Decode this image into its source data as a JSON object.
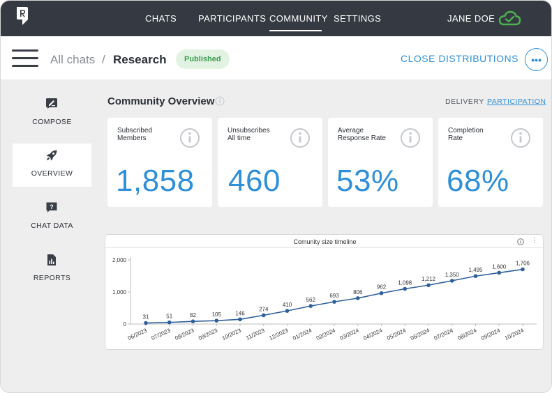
{
  "nav": {
    "items": [
      "CHATS",
      "PARTICIPANTS",
      "COMMUNITY",
      "SETTINGS"
    ],
    "active": "COMMUNITY",
    "user_name": "JANE DOE"
  },
  "header": {
    "breadcrumb_all": "All chats",
    "breadcrumb_sep": "/",
    "breadcrumb_current": "Research",
    "status_badge": "Published",
    "close_distributions": "CLOSE DISTRIBUTIONS",
    "more_label": "•••"
  },
  "sidebar": {
    "items": [
      {
        "label": "COMPOSE",
        "icon": "compose-icon",
        "active": false
      },
      {
        "label": "OVERVIEW",
        "icon": "rocket-icon",
        "active": true
      },
      {
        "label": "CHAT DATA",
        "icon": "chat-data-icon",
        "active": false
      },
      {
        "label": "REPORTS",
        "icon": "reports-icon",
        "active": false
      }
    ]
  },
  "overview": {
    "title": "Community Overview",
    "tabs": {
      "delivery": "DELIVERY",
      "participation": "PARTICIPATION",
      "active": "PARTICIPATION"
    },
    "cards": [
      {
        "label_line1": "Subscribed",
        "label_line2": "Members",
        "value": "1,858"
      },
      {
        "label_line1": "Unsubscribes",
        "label_line2": "All time",
        "value": "460"
      },
      {
        "label_line1": "Average",
        "label_line2": "Response Rate",
        "value": "53%"
      },
      {
        "label_line1": "Completion",
        "label_line2": "Rate",
        "value": "68%"
      }
    ]
  },
  "colors": {
    "accent": "#2f8fd8",
    "topbar": "#353a42",
    "line": "#2e5f9c",
    "published_text": "#3c9a4d",
    "published_bg": "#e3f3e3",
    "cloud": "#4caf50"
  },
  "chart_data": {
    "type": "line",
    "title": "Comunity size timeline",
    "x": [
      "06/2023",
      "07/2023",
      "08/2023",
      "09/2023",
      "10/2023",
      "11/2023",
      "12/2023",
      "01/2024",
      "02/2024",
      "03/2024",
      "04/2024",
      "05/2024",
      "06/2024",
      "07/2024",
      "08/2024",
      "09/2024",
      "10/2024"
    ],
    "series": [
      {
        "values": [
          31,
          51,
          82,
          105,
          146,
          274,
          410,
          562,
          693,
          806,
          962,
          1098,
          1212,
          1350,
          1495,
          1600,
          1706
        ]
      }
    ],
    "data_labels": [
      "31",
      "51",
      "82",
      "105",
      "146",
      "274",
      "410",
      "562",
      "693",
      "806",
      "962",
      "1,098",
      "1,212",
      "1,350",
      "1,495",
      "1,600",
      "1,706"
    ],
    "yticks": [
      0,
      1000,
      2000
    ],
    "ytick_labels": [
      "0",
      "1,000",
      "2,000"
    ],
    "ylim": [
      0,
      2000
    ],
    "grid": false,
    "legend": "none"
  }
}
